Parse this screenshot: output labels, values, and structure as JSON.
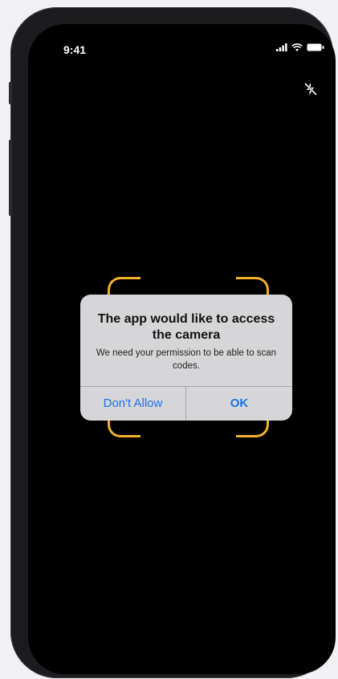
{
  "status_bar": {
    "time": "9:41"
  },
  "icons": {
    "signal": "signal-icon",
    "wifi": "wifi-icon",
    "battery": "battery-icon",
    "flash_off": "flash-off-icon"
  },
  "colors": {
    "scan_frame": "#f0b129",
    "button_text": "#1a73e8",
    "alert_bg": "#d6d6d8"
  },
  "alert": {
    "title": "The app would like to access the camera",
    "message": "We need your permission to be able to scan codes.",
    "deny_label": "Don't Allow",
    "ok_label": "OK"
  }
}
